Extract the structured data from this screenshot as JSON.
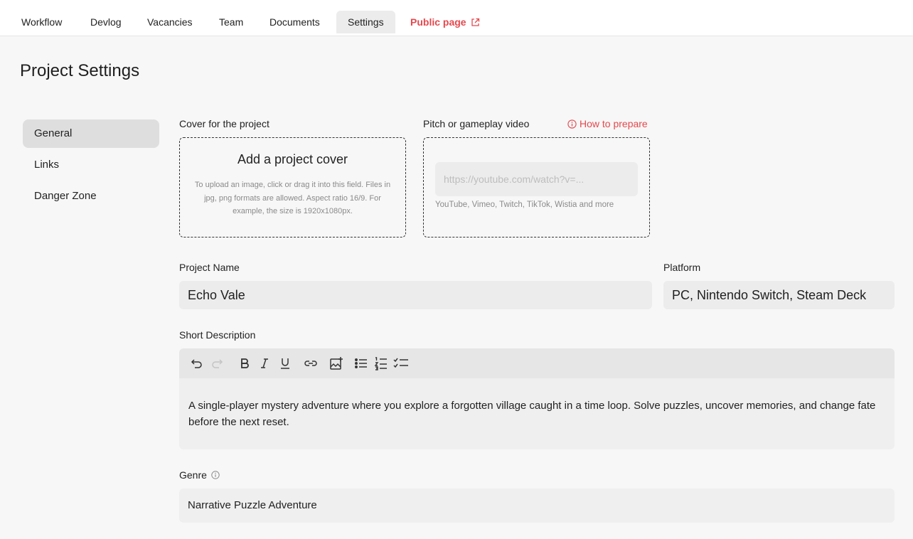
{
  "nav": {
    "tabs": [
      "Workflow",
      "Devlog",
      "Vacancies",
      "Team",
      "Documents",
      "Settings"
    ],
    "public_page": "Public page"
  },
  "page": {
    "title": "Project Settings"
  },
  "sidebar": {
    "items": [
      "General",
      "Links",
      "Danger Zone"
    ],
    "active": "General"
  },
  "cover": {
    "label": "Cover for the project",
    "title": "Add a project cover",
    "description": "To upload an image, click or drag it into this field. Files in jpg, png formats are allowed. Aspect ratio 16/9. For example, the size is 1920x1080px."
  },
  "video": {
    "label": "Pitch or gameplay video",
    "how_to": "How to prepare",
    "placeholder": "https://youtube.com/watch?v=...",
    "hint": "YouTube, Vimeo, Twitch, TikTok, Wistia and more"
  },
  "project_name": {
    "label": "Project Name",
    "value": "Echo Vale"
  },
  "platform": {
    "label": "Platform",
    "value": "PC, Nintendo Switch, Steam Deck"
  },
  "short_description": {
    "label": "Short Description",
    "value": "A single-player mystery adventure where you explore a forgotten village caught in a time loop. Solve puzzles, uncover memories, and change fate before the next reset."
  },
  "genre": {
    "label": "Genre",
    "value": "Narrative Puzzle Adventure"
  },
  "colors": {
    "accent": "#e5484d",
    "input_bg": "#ececec",
    "page_bg": "#f7f7f7"
  },
  "toolbar_icons": [
    "undo-icon",
    "redo-icon",
    "bold-icon",
    "italic-icon",
    "underline-icon",
    "link-icon",
    "image-icon",
    "bullet-list-icon",
    "numbered-list-icon",
    "checklist-icon"
  ]
}
